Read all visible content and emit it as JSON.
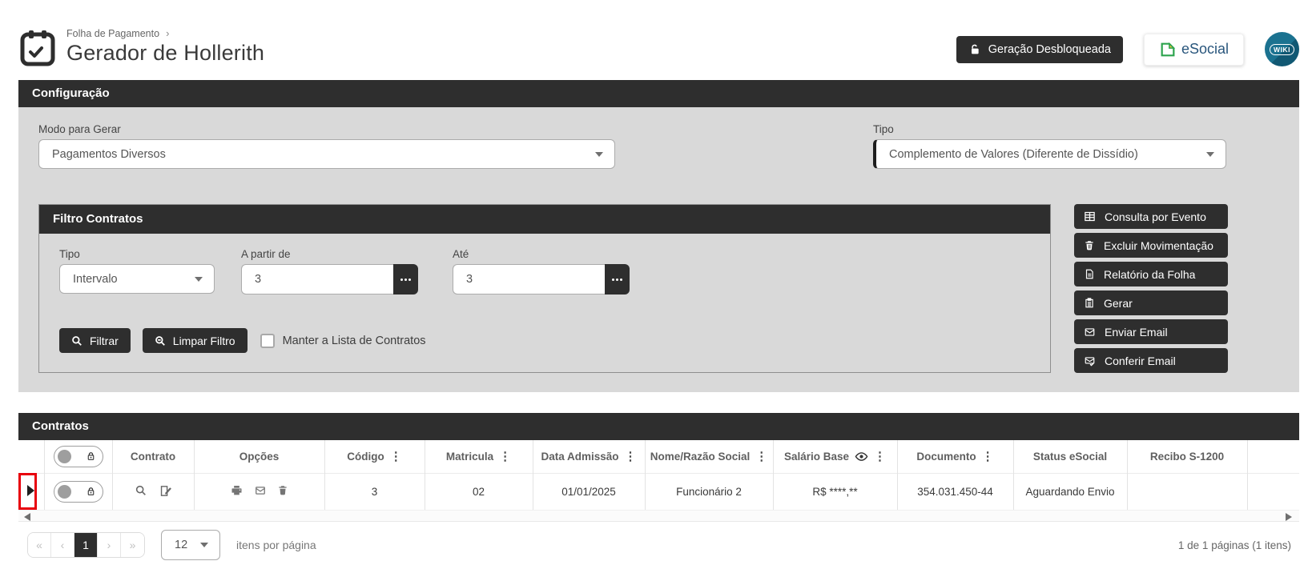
{
  "header": {
    "breadcrumb": "Folha de Pagamento",
    "title": "Gerador de Hollerith",
    "unlock_button": "Geração Desbloqueada",
    "esocial_button": "eSocial",
    "wiki_badge": "WIKI"
  },
  "config": {
    "title": "Configuração",
    "modo_label": "Modo para Gerar",
    "modo_value": "Pagamentos Diversos",
    "tipo_label": "Tipo",
    "tipo_value": "Complemento de Valores (Diferente de Dissídio)"
  },
  "filtro": {
    "title": "Filtro Contratos",
    "tipo_label": "Tipo",
    "tipo_value": "Intervalo",
    "from_label": "A partir de",
    "from_value": "3",
    "to_label": "Até",
    "to_value": "3",
    "filtrar_button": "Filtrar",
    "limpar_button": "Limpar Filtro",
    "checkbox_label": "Manter a Lista de Contratos"
  },
  "actions": {
    "consulta": {
      "label": "Consulta por Evento",
      "icon": "table-grid-icon"
    },
    "excluir": {
      "label": "Excluir Movimentação",
      "icon": "trash-icon"
    },
    "relatorio": {
      "label": "Relatório da Folha",
      "icon": "document-icon"
    },
    "gerar": {
      "label": "Gerar",
      "icon": "clipboard-icon"
    },
    "enviar": {
      "label": "Enviar Email",
      "icon": "envelope-icon"
    },
    "conferir": {
      "label": "Conferir Email",
      "icon": "envelope-check-icon"
    }
  },
  "contratos": {
    "title": "Contratos",
    "columns": {
      "contrato": "Contrato",
      "opcoes": "Opções",
      "codigo": "Código",
      "matricula": "Matricula",
      "data_admissao": "Data Admissão",
      "nome": "Nome/Razão Social",
      "salario": "Salário Base",
      "documento": "Documento",
      "status": "Status eSocial",
      "recibo": "Recibo S-1200"
    },
    "row": {
      "codigo": "3",
      "matricula": "02",
      "data_admissao": "01/01/2025",
      "nome": "Funcionário 2",
      "salario": "R$ ****,**",
      "documento": "354.031.450-44",
      "status": "Aguardando Envio",
      "recibo": ""
    }
  },
  "pagination": {
    "first": "«",
    "prev": "‹",
    "page": "1",
    "next": "›",
    "last": "»",
    "page_size": "12",
    "items_label": "itens por página",
    "summary": "1 de 1 páginas (1 itens)"
  },
  "icons": {
    "breadcrumb_chevron": "›",
    "kebab": "⋮"
  },
  "colors": {
    "dark": "#2e2e2e",
    "panel_gray": "#d9d9d9",
    "teal": "#1b7290",
    "esocial_blue": "#29567c",
    "highlight_red": "#e8000d"
  }
}
